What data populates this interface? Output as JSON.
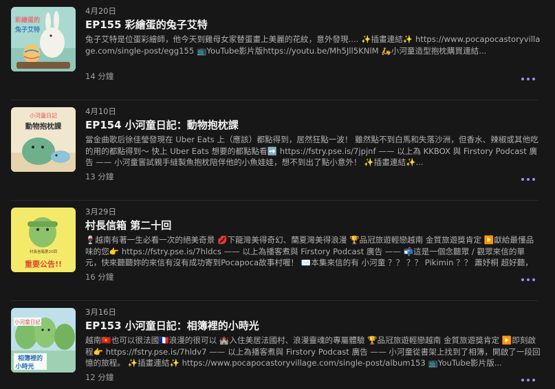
{
  "episodes": [
    {
      "date": "4月20日",
      "title": "EP155 彩繪蛋的兔子艾特",
      "description": "兔子艾特是位蛋彩繪師，他今天到雞母女家替蛋畫上美麗的花紋，意外發現.... ✨插畫連結✨ https://www.pocapocastoryvillage.com/single-post/egg155 📺YouTube影片版https://youtu.be/Mh5Jll5KNlM 🛵小河童造型抱枕購買連結...",
      "duration": "14 分鐘",
      "thumb_text": "彩繪蛋的兔子艾特"
    },
    {
      "date": "4月10日",
      "title": "EP154 小河童日記：動物抱枕課",
      "description": "當金曲歌后徐佳瑩發現在 Uber Eats 上（應該）都點得到，居然狂點一波！ 雖然點不到白馬和失落沙洲，但香水、辣椒或其他吃的用的都點得到～ 快上 Uber Eats 想要的都點點看➡️ https://fstry.pse.is/7jpjnf —— 以上為 KKBOX 與 Firstory Podcast 廣告 —— 小河童嘗試親手縫製魚抱枕陪伴他的小魚娃娃，想不到出了點小意外！ ✨插畫連結✨...",
      "duration": "13 分鐘",
      "thumb_text_top": "小河童日記",
      "thumb_text_main": "動物抱枕課"
    },
    {
      "date": "3月29日",
      "title": "村長信箱 第二十回",
      "description": "🍷越南有著一生必看一次的絕美奇景 💋下龍灣美得奇幻、蘭夏灣美得浪漫 🏆品冠旅遊輕戀越南 金質旅遊獎肯定 ▶️獻給最懂品味的您👉 https://fstry.pse.is/7hldcs —— 以上為播客煮與 Firstory Podcast 廣告 —— 📬這是一個念聽眾 / 觀眾來信的單元，快來聽聽妳的來信有沒有成功寄到Pocapoca故事村喔！ ✉️本集來信的有 小河童 ？？ ？？ Pikimin ？？ 蕭妤桐 超好聽，相望...",
      "duration": "16 分鐘",
      "thumb_text_top": "村長信箱第20回",
      "thumb_text_main": "重要公告!!"
    },
    {
      "date": "3月16日",
      "title": "EP153 小河童日記：相簿裡的小時光",
      "description": "越南🇻🇳也可以很法國🇫🇷浪漫的很可以 🏰入住美居法國村、浪漫靈魂的專屬體驗 🏆品冠旅遊輕戀越南 金質旅遊獎肯定 ▶️即刻啟程👉 https://fstry.pse.is/7hldv7 —— 以上為播客煮與 Firstory Podcast 廣告 —— 小河童從書架上找到了相簿，開啟了一段回憶的旅程。 ✨插畫連結✨ https://www.pocapocastoryvillage.com/single-post/album153 📺YouTube影片版...",
      "duration": "12 分鐘",
      "thumb_text_top": "小河童日記",
      "thumb_text_main": "相簿裡的小時光"
    }
  ],
  "colors": {
    "background": "#171717",
    "accent": "#a78bfa",
    "title": "#f2f2f2",
    "description": "#b0b0b0"
  },
  "icons": {
    "more": "more-options-icon"
  }
}
